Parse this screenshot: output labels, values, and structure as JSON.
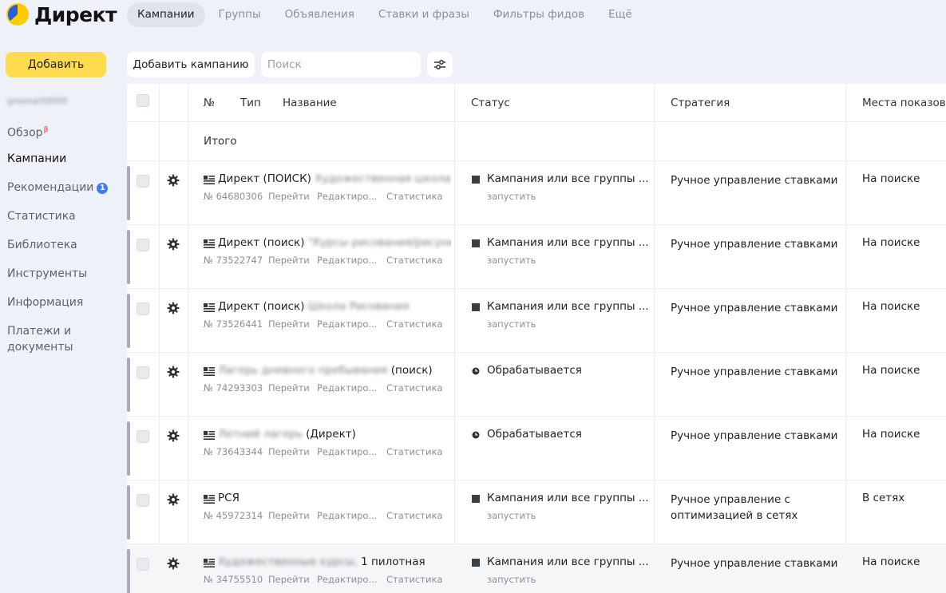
{
  "app": {
    "logo_text": "Директ"
  },
  "tabs": [
    {
      "label": "Кампании",
      "active": true
    },
    {
      "label": "Группы"
    },
    {
      "label": "Объявления"
    },
    {
      "label": "Ставки и фразы"
    },
    {
      "label": "Фильтры фидов"
    },
    {
      "label": "Ещё"
    }
  ],
  "sidebar": {
    "add_label": "Добавить",
    "username": "greenart0000",
    "items": [
      {
        "label": "Обзор",
        "beta": "β"
      },
      {
        "label": "Кампании",
        "active": true
      },
      {
        "label": "Рекомендации",
        "badge": "1"
      },
      {
        "label": "Статистика"
      },
      {
        "label": "Библиотека"
      },
      {
        "label": "Инструменты"
      },
      {
        "label": "Информация"
      },
      {
        "label": "Платежи и документы"
      }
    ]
  },
  "toolbar": {
    "add_campaign_label": "Добавить кампанию",
    "search_placeholder": "Поиск"
  },
  "table": {
    "headers": {
      "num": "№",
      "type": "Тип",
      "name": "Название",
      "status": "Статус",
      "strategy": "Стратегия",
      "places": "Места показов"
    },
    "total_label": "Итого",
    "link_go": "Перейти",
    "link_edit": "Редактиро...",
    "link_stats": "Статистика",
    "rows": [
      {
        "name_prefix": "Директ (ПОИСК)",
        "name_hidden": "Художественная школа Ut",
        "name_suffix": "",
        "id": "№ 64680306",
        "status": "Кампания или все группы ...",
        "status_sub": "запустить",
        "status_kind": "stopped",
        "strategy": "Ручное управление ставками",
        "places": "На поиске"
      },
      {
        "name_prefix": "Директ (поиск)",
        "name_hidden": "\"Курсы рисования/рисунка\"",
        "name_suffix": "",
        "id": "№ 73522747",
        "status": "Кампания или все группы ...",
        "status_sub": "запустить",
        "status_kind": "stopped",
        "strategy": "Ручное управление ставками",
        "places": "На поиске"
      },
      {
        "name_prefix": "Директ (поиск)",
        "name_hidden": "Школа Рисования",
        "name_suffix": "",
        "id": "№ 73526441",
        "status": "Кампания или все группы ...",
        "status_sub": "запустить",
        "status_kind": "stopped",
        "strategy": "Ручное управление ставками",
        "places": "На поиске"
      },
      {
        "name_prefix": "",
        "name_hidden": "Лагерь дневного пребывания",
        "name_suffix": "(поиск)",
        "id": "№ 74293303",
        "status": "Обрабатывается",
        "status_sub": "",
        "status_kind": "processing",
        "strategy": "Ручное управление ставками",
        "places": "На поиске"
      },
      {
        "name_prefix": "",
        "name_hidden": "Летний лагерь",
        "name_suffix": "(Директ)",
        "id": "№ 73643344",
        "status": "Обрабатывается",
        "status_sub": "",
        "status_kind": "processing",
        "strategy": "Ручное управление ставками",
        "places": "На поиске"
      },
      {
        "name_prefix": "РСЯ",
        "name_hidden": "",
        "name_suffix": "",
        "id": "№ 45972314",
        "status": "Кампания или все группы ...",
        "status_sub": "запустить",
        "status_kind": "stopped",
        "strategy": "Ручное управление с оптимизацией в сетях",
        "places": "В сетях"
      },
      {
        "name_prefix": "",
        "name_hidden": "Художественные курсы,",
        "name_suffix": "1 пилотная",
        "id": "№ 34755510",
        "status": "Кампания или все группы ...",
        "status_sub": "запустить",
        "status_kind": "stopped",
        "strategy": "Ручное управление ставками",
        "places": "На поиске"
      }
    ]
  },
  "colors": {
    "accent_yellow": "#ffdb4d",
    "badge_blue": "#3d7bf7",
    "beta_red": "#ff3333",
    "logo_blue": "#2b5fd9"
  }
}
